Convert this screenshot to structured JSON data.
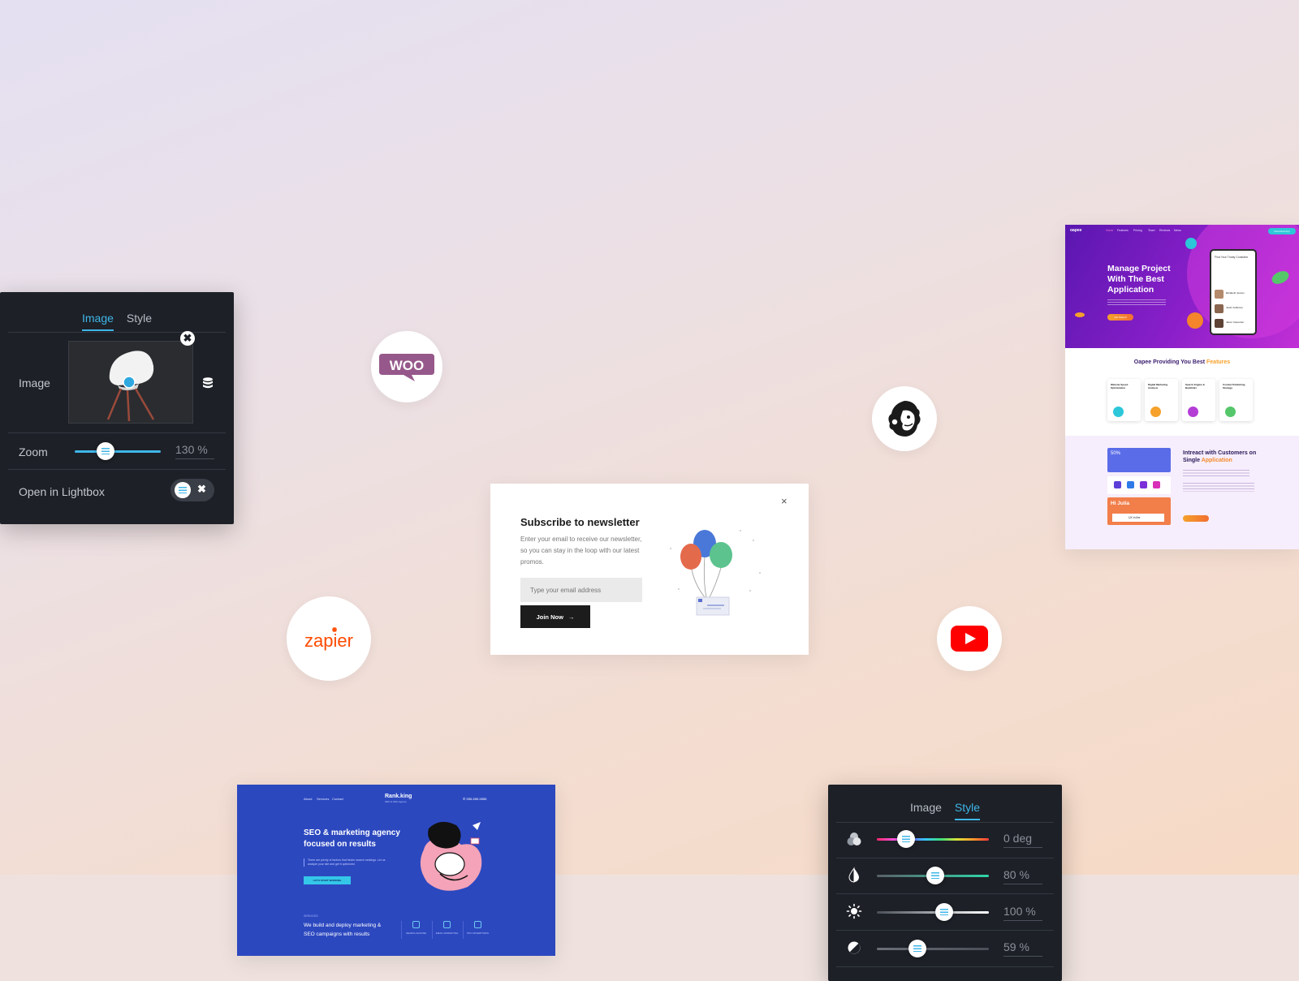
{
  "image_panel": {
    "tabs": [
      "Image",
      "Style"
    ],
    "active_tab": "Image",
    "image_label": "Image",
    "zoom_label": "Zoom",
    "zoom_value": "130 %",
    "zoom_fraction": 0.36,
    "lightbox_label": "Open in Lightbox",
    "remove_symbol": "✖",
    "toggle_x": "✖"
  },
  "style_panel": {
    "tabs": [
      "Image",
      "Style"
    ],
    "active_tab": "Style",
    "rows": [
      {
        "icon": "hue-icon",
        "value": "0 deg",
        "fraction": 0.26
      },
      {
        "icon": "saturation-drop-icon",
        "value": "80 %",
        "fraction": 0.52
      },
      {
        "icon": "brightness-sun-icon",
        "value": "100 %",
        "fraction": 0.6
      },
      {
        "icon": "contrast-icon",
        "value": "59 %",
        "fraction": 0.36
      }
    ]
  },
  "brands": {
    "woo": "WOO",
    "zapier": "zapier"
  },
  "newsletter": {
    "title": "Subscribe to newsletter",
    "description": "Enter your email to receive our newsletter, so you can stay in the loop with our latest promos.",
    "placeholder": "Type your email address",
    "button": "Join Now",
    "close": "×"
  },
  "oapee": {
    "logo": "oapee",
    "nav": [
      "Home",
      "Features",
      "Pricing",
      "Team",
      "Reviews",
      "News"
    ],
    "header_button": "Download App",
    "headline": "Manage Project With The Best Application",
    "hero_button": "Get Started",
    "phone_title": "Find Your Trusty Consultor",
    "contacts": [
      "Elizabeth Jenson",
      "Justin Jefferson",
      "Jason Carpenter"
    ],
    "features_title_main": "Oapee Providing You Best ",
    "features_title_highlight": "Features",
    "features": [
      "Website Speed Optimization",
      "Digital Marketing Analysis",
      "Search Engine & Backlinks",
      "Content Publishing Strategy"
    ],
    "stat_value": "50%",
    "card_name": "Hi Julia",
    "card_sub": "UX in the",
    "section_title_main": "Intreact with Customers on Single ",
    "section_title_highlight": "Application"
  },
  "rankking": {
    "nav": [
      "About",
      "Services",
      "Contact"
    ],
    "brand": "Rank.king",
    "tagline_small": "SEO & Web Agency",
    "phone": "555-555-5555",
    "headline": "SEO & marketing agency focused on results",
    "description": "There are plenty of factors that hinder search rankings. Let us analyze your site and get it optimized.",
    "cta": "LET'S START WORKING",
    "services_label": "SERVICES",
    "tagline": "We build and deploy marketing & SEO campaigns with results",
    "features": [
      "SEARCH ENGINE",
      "EMAIL MARKETING",
      "PPC ADVERTISING"
    ]
  },
  "colors": {
    "panel_bg": "#1d2027",
    "accent": "#3fb6e8",
    "woo_purple": "#96588a",
    "zapier_orange": "#ff4a00",
    "youtube_red": "#ff0000",
    "oapee_purple": "#6a1bc0",
    "rankking_blue": "#2c48bf"
  }
}
